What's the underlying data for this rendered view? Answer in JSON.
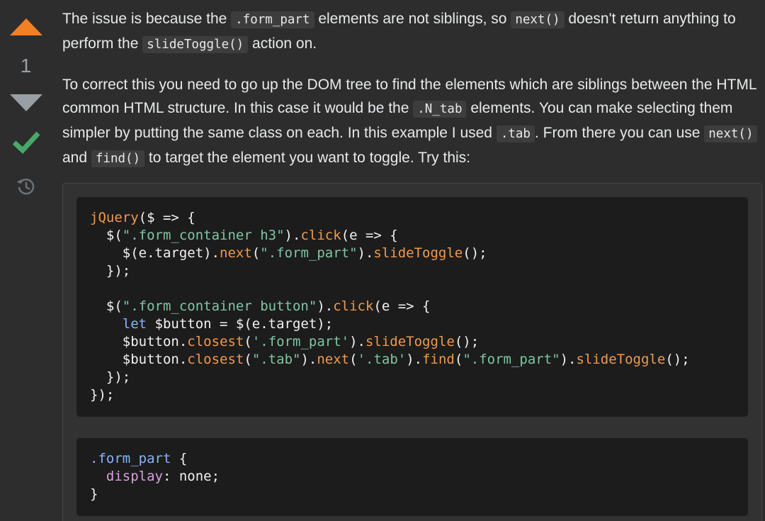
{
  "vote": {
    "score": "1"
  },
  "answer": {
    "paragraph_1": {
      "t1": "The issue is because the ",
      "c1": ".form_part",
      "t2": " elements are not siblings, so ",
      "c2": "next()",
      "t3": " doesn't return anything to perform the ",
      "c3": "slideToggle()",
      "t4": " action on."
    },
    "paragraph_2": {
      "t1": "To correct this you need to go up the DOM tree to find the elements which are siblings between the HTML common HTML structure. In this case it would be the ",
      "c1": ".N_tab",
      "t2": " elements. You can make selecting them simpler by putting the same class on each. In this example I used ",
      "c2": ".tab",
      "t3": ". From there you can use ",
      "c3": "next()",
      "t4": " and ",
      "c4": "find()",
      "t5": " to target the element you want to toggle. Try this:"
    }
  },
  "code": {
    "js_lines": [
      "jQuery($ => {",
      "  $(\".form_container h3\").click(e => {",
      "    $(e.target).next(\".form_part\").slideToggle();",
      "  });",
      "",
      "  $(\".form_container button\").click(e => {",
      "    let $button = $(e.target);",
      "    $button.closest('.form_part').slideToggle();",
      "    $button.closest(\".tab\").next('.tab').find(\".form_part\").slideToggle();",
      "  });",
      "});"
    ],
    "css_lines": [
      ".form_part {",
      "  display: none;",
      "}"
    ]
  },
  "colors": {
    "upvote": "#f48024",
    "accepted": "#48a868",
    "muted": "#9a9fa5",
    "background": "#2d2d2d",
    "code_background": "#1c1c1c"
  },
  "icons": [
    "upvote-arrow-icon",
    "downvote-arrow-icon",
    "accepted-check-icon",
    "history-icon"
  ]
}
